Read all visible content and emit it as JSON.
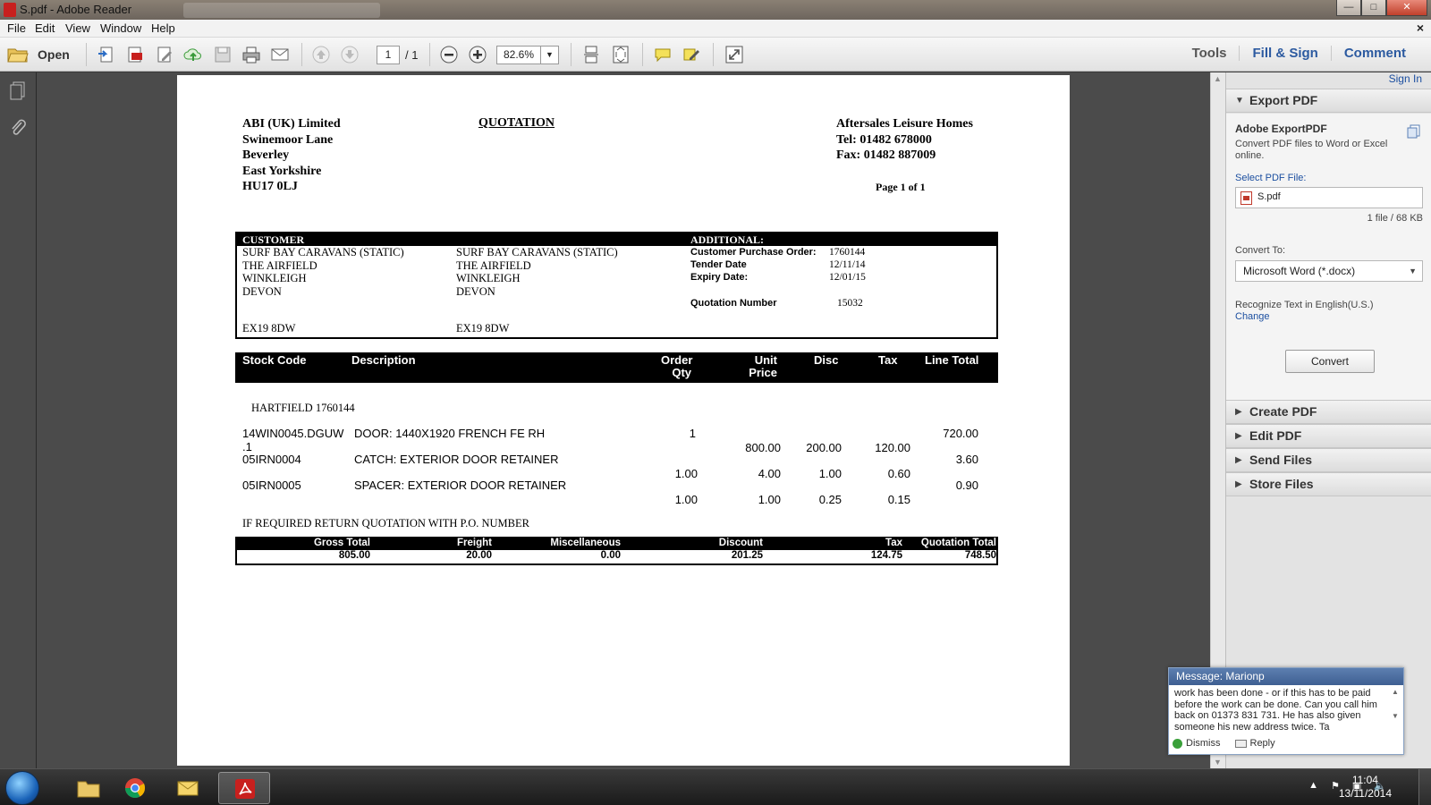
{
  "window": {
    "title": "S.pdf - Adobe Reader",
    "min_symbol": "—",
    "max_symbol": "□",
    "close_symbol": "✕",
    "doc_close_symbol": "×"
  },
  "menu": [
    "File",
    "Edit",
    "View",
    "Window",
    "Help"
  ],
  "toolbar": {
    "open_label": "Open",
    "page_current": "1",
    "page_total": "/ 1",
    "zoom": "82.6%",
    "tools_label": "Tools",
    "fill_sign_label": "Fill & Sign",
    "comment_label": "Comment"
  },
  "document": {
    "company_lines": [
      "ABI (UK) Limited",
      "Swinemoor Lane",
      "Beverley",
      "East Yorkshire",
      "HU17 0LJ"
    ],
    "title": "QUOTATION",
    "seller_lines": [
      "Aftersales Leisure Homes",
      "Tel: 01482 678000",
      "Fax: 01482 887009"
    ],
    "page_of": "Page 1 of 1",
    "customer_header": "CUSTOMER",
    "additional_header": "ADDITIONAL:",
    "customer_addr1": [
      "SURF BAY CARAVANS (STATIC)",
      "THE AIRFIELD",
      "WINKLEIGH",
      "DEVON"
    ],
    "customer_addr2": [
      "SURF BAY CARAVANS (STATIC)",
      "THE AIRFIELD",
      "WINKLEIGH",
      "DEVON"
    ],
    "customer_postcode1": "EX19 8DW",
    "customer_postcode2": "EX19 8DW",
    "additional": [
      {
        "label": "Customer Purchase Order:",
        "value": "1760144"
      },
      {
        "label": "Tender Date",
        "value": "12/11/14"
      },
      {
        "label": "Expiry Date:",
        "value": "12/01/15"
      },
      {
        "label": "Quotation Number",
        "value": "15032"
      }
    ],
    "table_headers": {
      "stock_code": "Stock Code",
      "description": "Description",
      "order_qty_1": "Order",
      "order_qty_2": "Qty",
      "unit_price_1": "Unit",
      "unit_price_2": "Price",
      "disc": "Disc",
      "tax": "Tax",
      "line_total": "Line Total"
    },
    "ref_line": "HARTFIELD 1760144",
    "items": [
      {
        "code": "14WIN0045.DGUW",
        "code2": ".1",
        "desc": "DOOR: 1440X1920 FRENCH FE RH",
        "qty": "1",
        "line_total": "720.00",
        "unit_price": "800.00",
        "disc": "200.00",
        "tax": "120.00"
      },
      {
        "code": "05IRN0004",
        "desc": "CATCH: EXTERIOR DOOR RETAINER",
        "line_total": "3.60",
        "qty": "1.00",
        "unit_price": "4.00",
        "disc": "1.00",
        "tax": "0.60"
      },
      {
        "code": "05IRN0005",
        "desc": "SPACER: EXTERIOR DOOR RETAINER",
        "line_total": "0.90",
        "qty": "1.00",
        "unit_price": "1.00",
        "disc": "0.25",
        "tax": "0.15"
      }
    ],
    "note": "IF REQUIRED RETURN QUOTATION WITH P.O. NUMBER",
    "totals": {
      "gross_total_label": "Gross Total",
      "gross_total": "805.00",
      "freight_label": "Freight",
      "freight": "20.00",
      "misc_label": "Miscellaneous",
      "misc": "0.00",
      "discount_label": "Discount",
      "discount": "201.25",
      "tax_label": "Tax",
      "tax": "124.75",
      "quotation_total_label": "Quotation Total",
      "quotation_total": "748.50"
    }
  },
  "right_panel": {
    "sign_in": "Sign In",
    "export_pdf": "Export PDF",
    "adobe_exportpdf": "Adobe ExportPDF",
    "export_desc": "Convert PDF files to Word or Excel online.",
    "select_pdf": "Select PDF File:",
    "file_name": "S.pdf",
    "file_info": "1 file / 68 KB",
    "convert_to": "Convert To:",
    "convert_option": "Microsoft Word (*.docx)",
    "recognize": "Recognize Text in English(U.S.)",
    "change": "Change",
    "convert_button": "Convert",
    "sections": [
      "Create PDF",
      "Edit PDF",
      "Send Files",
      "Store Files"
    ]
  },
  "message": {
    "title": "Message: Marionp",
    "body": "work has been done - or if this has to be paid before the work can be done. Can you call him back on 01373 831 731. He has also given someone his new address twice. Ta",
    "dismiss": "Dismiss",
    "reply": "Reply"
  },
  "taskbar": {
    "time": "11:04",
    "date": "13/11/2014"
  },
  "colors": {
    "accent_link": "#1c4fa0",
    "pdf_red": "#c8201e"
  }
}
